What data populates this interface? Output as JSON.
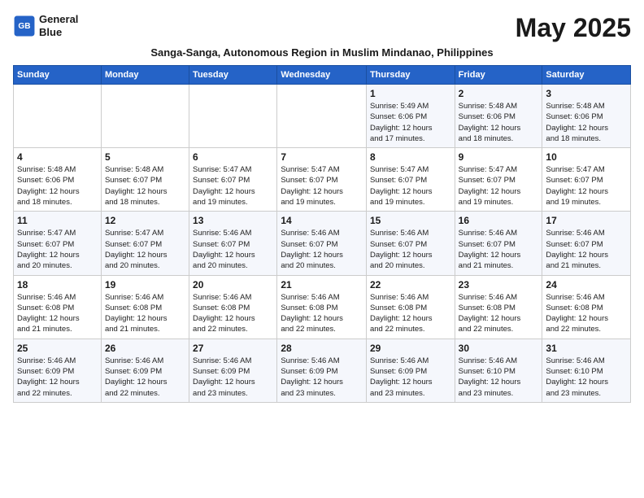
{
  "logo": {
    "line1": "General",
    "line2": "Blue"
  },
  "title": "May 2025",
  "subtitle": "Sanga-Sanga, Autonomous Region in Muslim Mindanao, Philippines",
  "days_of_week": [
    "Sunday",
    "Monday",
    "Tuesday",
    "Wednesday",
    "Thursday",
    "Friday",
    "Saturday"
  ],
  "weeks": [
    [
      {
        "day": "",
        "info": ""
      },
      {
        "day": "",
        "info": ""
      },
      {
        "day": "",
        "info": ""
      },
      {
        "day": "",
        "info": ""
      },
      {
        "day": "1",
        "info": "Sunrise: 5:49 AM\nSunset: 6:06 PM\nDaylight: 12 hours\nand 17 minutes."
      },
      {
        "day": "2",
        "info": "Sunrise: 5:48 AM\nSunset: 6:06 PM\nDaylight: 12 hours\nand 18 minutes."
      },
      {
        "day": "3",
        "info": "Sunrise: 5:48 AM\nSunset: 6:06 PM\nDaylight: 12 hours\nand 18 minutes."
      }
    ],
    [
      {
        "day": "4",
        "info": "Sunrise: 5:48 AM\nSunset: 6:06 PM\nDaylight: 12 hours\nand 18 minutes."
      },
      {
        "day": "5",
        "info": "Sunrise: 5:48 AM\nSunset: 6:07 PM\nDaylight: 12 hours\nand 18 minutes."
      },
      {
        "day": "6",
        "info": "Sunrise: 5:47 AM\nSunset: 6:07 PM\nDaylight: 12 hours\nand 19 minutes."
      },
      {
        "day": "7",
        "info": "Sunrise: 5:47 AM\nSunset: 6:07 PM\nDaylight: 12 hours\nand 19 minutes."
      },
      {
        "day": "8",
        "info": "Sunrise: 5:47 AM\nSunset: 6:07 PM\nDaylight: 12 hours\nand 19 minutes."
      },
      {
        "day": "9",
        "info": "Sunrise: 5:47 AM\nSunset: 6:07 PM\nDaylight: 12 hours\nand 19 minutes."
      },
      {
        "day": "10",
        "info": "Sunrise: 5:47 AM\nSunset: 6:07 PM\nDaylight: 12 hours\nand 19 minutes."
      }
    ],
    [
      {
        "day": "11",
        "info": "Sunrise: 5:47 AM\nSunset: 6:07 PM\nDaylight: 12 hours\nand 20 minutes."
      },
      {
        "day": "12",
        "info": "Sunrise: 5:47 AM\nSunset: 6:07 PM\nDaylight: 12 hours\nand 20 minutes."
      },
      {
        "day": "13",
        "info": "Sunrise: 5:46 AM\nSunset: 6:07 PM\nDaylight: 12 hours\nand 20 minutes."
      },
      {
        "day": "14",
        "info": "Sunrise: 5:46 AM\nSunset: 6:07 PM\nDaylight: 12 hours\nand 20 minutes."
      },
      {
        "day": "15",
        "info": "Sunrise: 5:46 AM\nSunset: 6:07 PM\nDaylight: 12 hours\nand 20 minutes."
      },
      {
        "day": "16",
        "info": "Sunrise: 5:46 AM\nSunset: 6:07 PM\nDaylight: 12 hours\nand 21 minutes."
      },
      {
        "day": "17",
        "info": "Sunrise: 5:46 AM\nSunset: 6:07 PM\nDaylight: 12 hours\nand 21 minutes."
      }
    ],
    [
      {
        "day": "18",
        "info": "Sunrise: 5:46 AM\nSunset: 6:08 PM\nDaylight: 12 hours\nand 21 minutes."
      },
      {
        "day": "19",
        "info": "Sunrise: 5:46 AM\nSunset: 6:08 PM\nDaylight: 12 hours\nand 21 minutes."
      },
      {
        "day": "20",
        "info": "Sunrise: 5:46 AM\nSunset: 6:08 PM\nDaylight: 12 hours\nand 22 minutes."
      },
      {
        "day": "21",
        "info": "Sunrise: 5:46 AM\nSunset: 6:08 PM\nDaylight: 12 hours\nand 22 minutes."
      },
      {
        "day": "22",
        "info": "Sunrise: 5:46 AM\nSunset: 6:08 PM\nDaylight: 12 hours\nand 22 minutes."
      },
      {
        "day": "23",
        "info": "Sunrise: 5:46 AM\nSunset: 6:08 PM\nDaylight: 12 hours\nand 22 minutes."
      },
      {
        "day": "24",
        "info": "Sunrise: 5:46 AM\nSunset: 6:08 PM\nDaylight: 12 hours\nand 22 minutes."
      }
    ],
    [
      {
        "day": "25",
        "info": "Sunrise: 5:46 AM\nSunset: 6:09 PM\nDaylight: 12 hours\nand 22 minutes."
      },
      {
        "day": "26",
        "info": "Sunrise: 5:46 AM\nSunset: 6:09 PM\nDaylight: 12 hours\nand 22 minutes."
      },
      {
        "day": "27",
        "info": "Sunrise: 5:46 AM\nSunset: 6:09 PM\nDaylight: 12 hours\nand 23 minutes."
      },
      {
        "day": "28",
        "info": "Sunrise: 5:46 AM\nSunset: 6:09 PM\nDaylight: 12 hours\nand 23 minutes."
      },
      {
        "day": "29",
        "info": "Sunrise: 5:46 AM\nSunset: 6:09 PM\nDaylight: 12 hours\nand 23 minutes."
      },
      {
        "day": "30",
        "info": "Sunrise: 5:46 AM\nSunset: 6:10 PM\nDaylight: 12 hours\nand 23 minutes."
      },
      {
        "day": "31",
        "info": "Sunrise: 5:46 AM\nSunset: 6:10 PM\nDaylight: 12 hours\nand 23 minutes."
      }
    ]
  ]
}
